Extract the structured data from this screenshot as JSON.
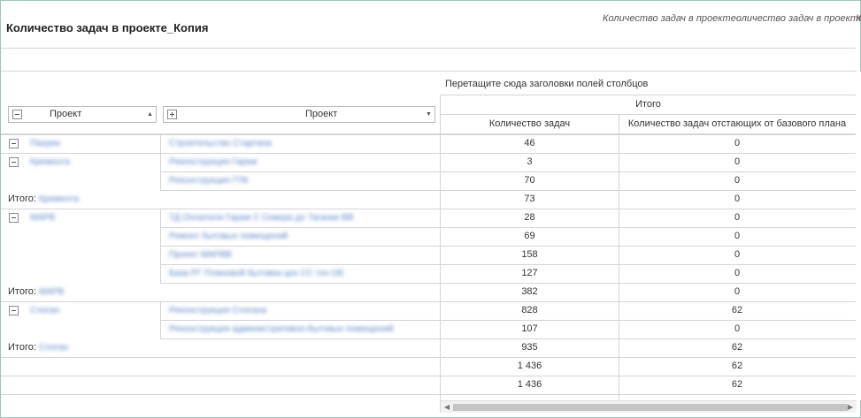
{
  "header": {
    "title": "Количество задач в проекте_Копия",
    "subtitle": "Количество задач в проекте",
    "subtitle2": "оличество задач в проекте",
    "subtitle_trunc": "К"
  },
  "pivot": {
    "drop_hint": "Перетащите сюда заголовки полей столбцов",
    "grand_header": "Итого",
    "columns": [
      "Количество задач",
      "Количество задач отстающих от базового плана"
    ],
    "row_fields": [
      "Проект",
      "Проект"
    ],
    "total_label": "Итого:",
    "rows": [
      {
        "g": "Пахрин",
        "p": "Строительство Стартапа",
        "v1": "46",
        "v2": "0"
      },
      {
        "g": "Кремента",
        "p": "Реконструкция Гараж",
        "v1": "3",
        "v2": "0"
      },
      {
        "g": "",
        "p": "Реконструкция ГПК",
        "v1": "70",
        "v2": "0"
      },
      {
        "total": "Кремента",
        "v1": "73",
        "v2": "0"
      },
      {
        "g": "МАРВ",
        "p": "ТД Оплатили Гараж С Севера до Таганки ВВ",
        "v1": "28",
        "v2": "0"
      },
      {
        "g": "",
        "p": "Ремонт бытовых помещений",
        "v1": "69",
        "v2": "0"
      },
      {
        "g": "",
        "p": "Проект МАРВВ",
        "v1": "158",
        "v2": "0"
      },
      {
        "g": "",
        "p": "База РГ Плановой бытовка цех СС точ ОЕ",
        "v1": "127",
        "v2": "0"
      },
      {
        "total": "МАРВ",
        "v1": "382",
        "v2": "0"
      },
      {
        "g": "Слоган",
        "p": "Реконструкция Слогана",
        "v1": "828",
        "v2": "62"
      },
      {
        "g": "",
        "p": "Реконструкция административно-бытовых помещений",
        "v1": "107",
        "v2": "0"
      },
      {
        "total": "Слоган",
        "v1": "935",
        "v2": "62"
      },
      {
        "blank": true,
        "v1": "1 436",
        "v2": "62"
      },
      {
        "blank": true,
        "v1": "1 436",
        "v2": "62"
      }
    ]
  }
}
